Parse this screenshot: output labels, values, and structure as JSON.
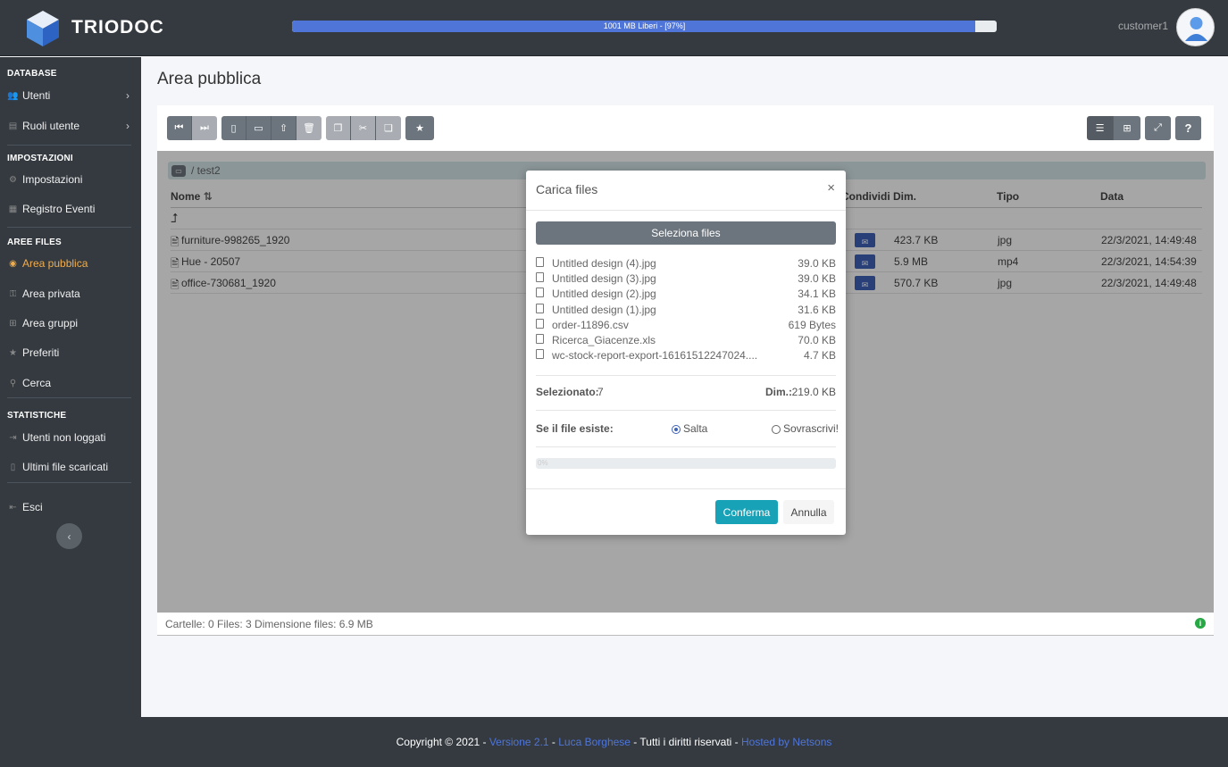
{
  "app": {
    "brand": "TRIODOC"
  },
  "header": {
    "quota_text": "1001 MB Liberi - [97%]",
    "quota_fraction": 0.97,
    "user": "customer1"
  },
  "sidebar": {
    "sections": {
      "database": "DATABASE",
      "impostazioni": "IMPOSTAZIONI",
      "aree_files": "AREE FILES",
      "statistiche": "STATISTICHE"
    },
    "items": {
      "utenti": "Utenti",
      "ruoli": "Ruoli utente",
      "impostazioni": "Impostazioni",
      "registro": "Registro Eventi",
      "pubblica": "Area pubblica",
      "privata": "Area privata",
      "gruppi": "Area gruppi",
      "preferiti": "Preferiti",
      "cerca": "Cerca",
      "non_loggati": "Utenti non loggati",
      "scaricati": "Ultimi file scaricati",
      "esci": "Esci"
    }
  },
  "main": {
    "title": "Area pubblica",
    "breadcrumb": "/ test2",
    "columns": {
      "nome": "Nome",
      "condividi": "Condividi",
      "dim": "Dim.",
      "tipo": "Tipo",
      "data": "Data"
    },
    "up": "⮥",
    "files": [
      {
        "name": "furniture-998265_1920",
        "size": "423.7 KB",
        "type": "jpg",
        "date": "22/3/2021, 14:49:48"
      },
      {
        "name": "Hue - 20507",
        "size": "5.9 MB",
        "type": "mp4",
        "date": "22/3/2021, 14:54:39"
      },
      {
        "name": "office-730681_1920",
        "size": "570.7 KB",
        "type": "jpg",
        "date": "22/3/2021, 14:49:48"
      }
    ],
    "status": "Cartelle: 0 Files: 3 Dimensione files: 6.9 MB"
  },
  "modal": {
    "title": "Carica files",
    "close": "×",
    "select_btn": "Seleziona files",
    "files": [
      {
        "name": "Untitled design (4).jpg",
        "size": "39.0 KB"
      },
      {
        "name": "Untitled design (3).jpg",
        "size": "39.0 KB"
      },
      {
        "name": "Untitled design (2).jpg",
        "size": "34.1 KB"
      },
      {
        "name": "Untitled design (1).jpg",
        "size": "31.6 KB"
      },
      {
        "name": "order-11896.csv",
        "size": "619 Bytes"
      },
      {
        "name": "Ricerca_Giacenze.xls",
        "size": "70.0 KB"
      },
      {
        "name": "wc-stock-report-export-16161512247024....",
        "size": "4.7 KB"
      }
    ],
    "selected_label": "Selezionato:",
    "selected_value": "7",
    "dim_label": "Dim.:",
    "dim_value": "219.0 KB",
    "exists_label": "Se il file esiste:",
    "opt_skip": "Salta",
    "opt_overwrite": "Sovrascrivi!",
    "progress": "0%",
    "confirm": "Conferma",
    "cancel": "Annulla"
  },
  "footer": {
    "copyright": "Copyright © 2021 - ",
    "version": "Versione 2.1",
    "sep1": " - ",
    "author": "Luca Borghese",
    "rights": " - Tutti i diritti riservati - ",
    "hosted": "Hosted by Netsons"
  }
}
